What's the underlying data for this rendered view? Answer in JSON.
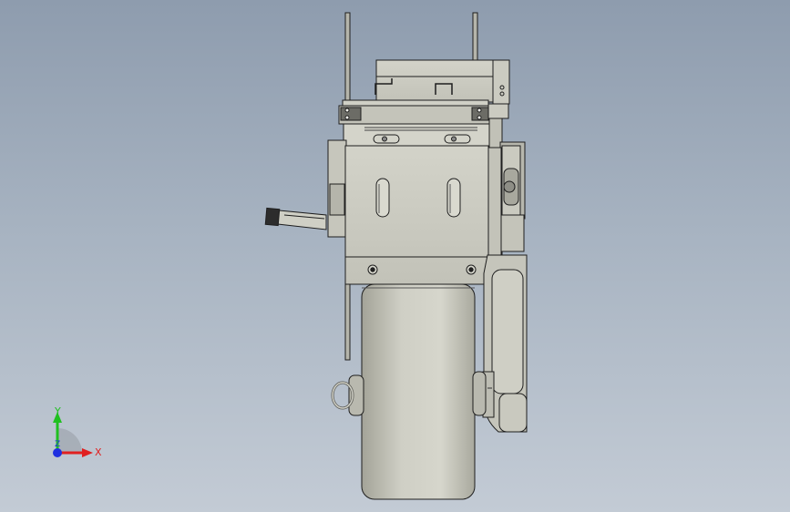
{
  "viewport": {
    "background_top": "#8e9cae",
    "background_bottom": "#c3cbd5"
  },
  "model": {
    "part_color": "#c9c9bf",
    "shadow_color": "#9e9e94",
    "edge_color": "#1e1e1e"
  },
  "triad": {
    "x_label": "X",
    "y_label": "Y",
    "z_label": "Z",
    "x_color": "#e02020",
    "y_color": "#20c020",
    "z_color": "#2030e0"
  }
}
